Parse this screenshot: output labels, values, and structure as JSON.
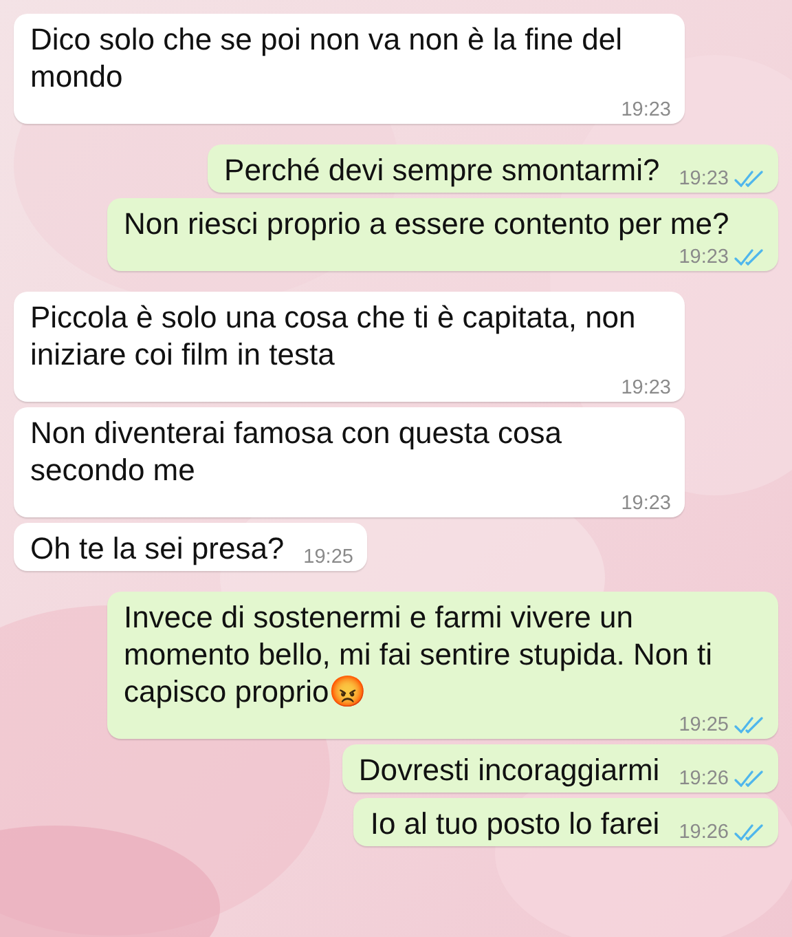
{
  "messages": [
    {
      "kind": "received",
      "text": "Dico solo che se poi non va non è la fine del mondo",
      "time": "19:23"
    },
    {
      "kind": "sent",
      "text": "Perché devi sempre smontarmi?",
      "time": "19:23",
      "read": true
    },
    {
      "kind": "sent",
      "text": "Non riesci proprio a essere contento per me?",
      "time": "19:23",
      "read": true
    },
    {
      "kind": "received",
      "text": "Piccola è solo una cosa che ti è capitata, non iniziare coi film in testa",
      "time": "19:23"
    },
    {
      "kind": "received",
      "text": "Non diventerai famosa con questa cosa secondo me",
      "time": "19:23"
    },
    {
      "kind": "received",
      "text": "Oh te la sei presa?",
      "time": "19:25"
    },
    {
      "kind": "sent",
      "text": "Invece di sostenermi e farmi vivere un momento bello, mi fai sentire stupida. Non ti capisco proprio😡",
      "time": "19:25",
      "read": true
    },
    {
      "kind": "sent",
      "text": "Dovresti incoraggiarmi",
      "time": "19:26",
      "read": true
    },
    {
      "kind": "sent",
      "text": "Io al tuo posto lo farei",
      "time": "19:26",
      "read": true
    }
  ]
}
